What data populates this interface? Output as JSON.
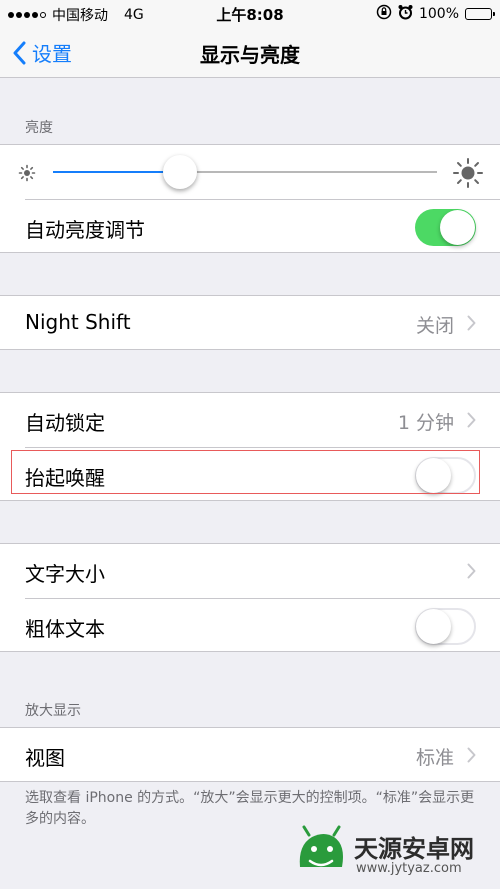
{
  "status_bar": {
    "carrier": "中国移动",
    "network": "4G",
    "time": "上午8:08",
    "battery": "100%"
  },
  "nav": {
    "back_label": "设置",
    "title": "显示与亮度"
  },
  "brightness": {
    "header": "亮度",
    "level": 0.33,
    "auto_label": "自动亮度调节",
    "auto_on": true
  },
  "night_shift": {
    "label": "Night Shift",
    "value": "关闭"
  },
  "lock": {
    "auto_lock_label": "自动锁定",
    "auto_lock_value": "1 分钟",
    "raise_to_wake_label": "抬起唤醒",
    "raise_to_wake_on": false
  },
  "text": {
    "size_label": "文字大小",
    "bold_label": "粗体文本",
    "bold_on": false
  },
  "zoom": {
    "header": "放大显示",
    "view_label": "视图",
    "view_value": "标准",
    "footer": "选取查看 iPhone 的方式。“放大”会显示更大的控制项。“标准”会显示更多的内容。"
  },
  "watermark": {
    "title": "天源安卓网",
    "url": "www.jytyaz.com"
  },
  "colors": {
    "accent": "#157efb",
    "toggle_on": "#4cd964",
    "highlight_border": "#e85a5a"
  }
}
